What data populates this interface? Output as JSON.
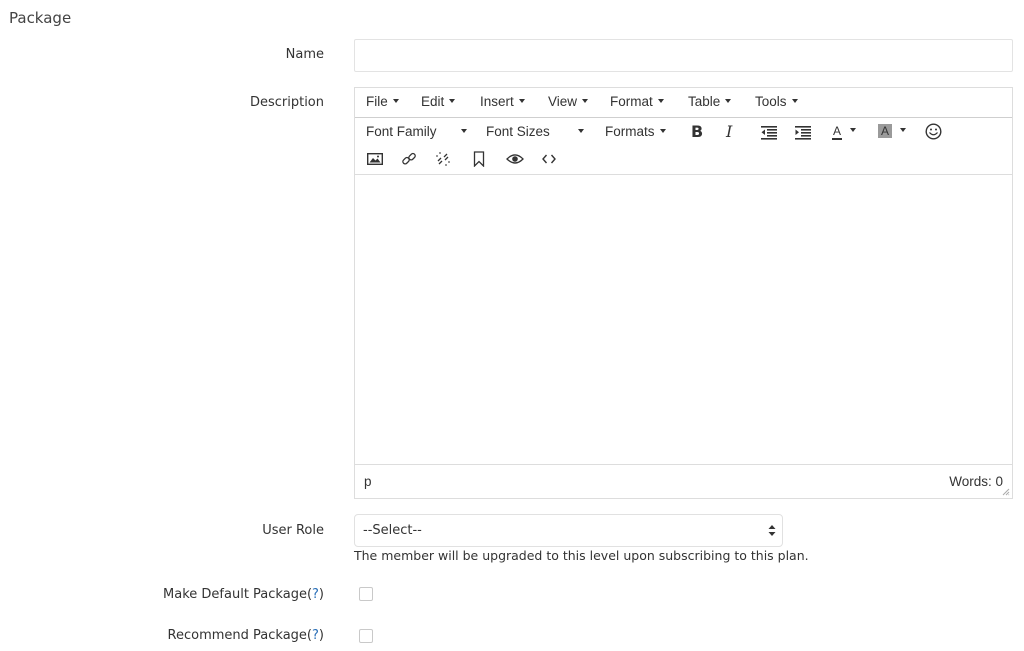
{
  "section_title": "Package",
  "fields": {
    "name": {
      "label": "Name",
      "value": "",
      "placeholder": ""
    },
    "description": {
      "label": "Description"
    },
    "user_role": {
      "label": "User Role",
      "selected": "--Select--",
      "help_text": "The member will be upgraded to this level upon subscribing to this plan."
    },
    "make_default": {
      "label": "Make Default Package(",
      "help": "?",
      "label_end": ")",
      "checked": false
    },
    "recommend": {
      "label": "Recommend Package(",
      "help": "?",
      "label_end": ")",
      "checked": false
    }
  },
  "editor": {
    "menubar": [
      "File",
      "Edit",
      "Insert",
      "View",
      "Format",
      "Table",
      "Tools"
    ],
    "toolbar": {
      "font_family": "Font Family",
      "font_sizes": "Font Sizes",
      "formats": "Formats",
      "buttons": [
        "bold-icon",
        "italic-icon",
        "outdent-icon",
        "indent-icon",
        "text-color-icon",
        "background-color-icon",
        "emoticons-icon",
        "image-icon",
        "link-icon",
        "unlink-icon",
        "bookmark-icon",
        "preview-icon",
        "code-icon"
      ],
      "bold_glyph": "B",
      "italic_glyph": "I",
      "color_glyph": "A"
    },
    "content": "",
    "status_path": "p",
    "word_count": "Words: 0"
  },
  "colors": {
    "help_link": "#2a6fb8",
    "border": "#dddddd"
  }
}
